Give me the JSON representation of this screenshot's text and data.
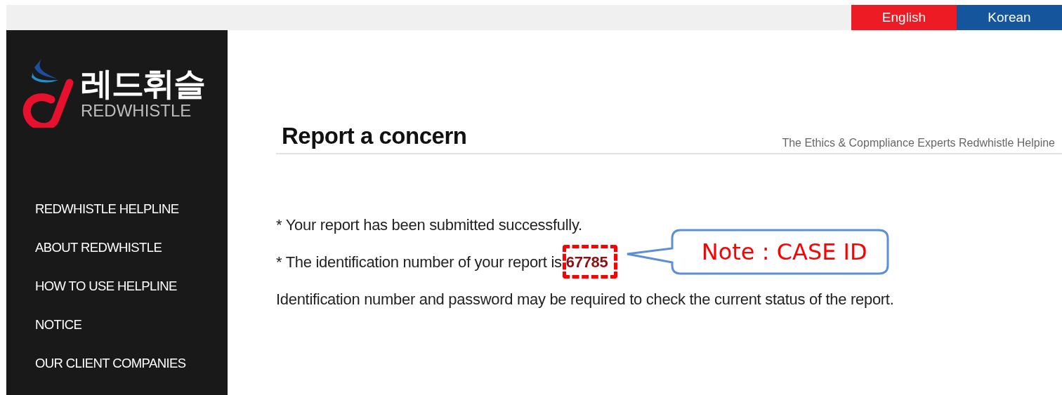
{
  "languages": [
    {
      "label": "English",
      "color": "#ed1c24"
    },
    {
      "label": "Korean",
      "color": "#14559c"
    }
  ],
  "sidebar": {
    "logo": {
      "korean": "레드휘슬",
      "english": "REDWHISTLE"
    },
    "items": [
      "REDWHISTLE HELPLINE",
      "ABOUT REDWHISTLE",
      "HOW TO USE HELPLINE",
      "NOTICE",
      "OUR CLIENT COMPANIES"
    ]
  },
  "page": {
    "title": "Report a concern",
    "subtitle": "The Ethics & Copmpliance Experts Redwhistle Helpine",
    "success_message": "* Your report has been submitted successfully.",
    "id_message": "* The identification number of your report is",
    "case_id": "67785",
    "note": "Identification number and password may be required to check the current status of the report."
  },
  "annotation": {
    "text": "Note : CASE ID"
  }
}
